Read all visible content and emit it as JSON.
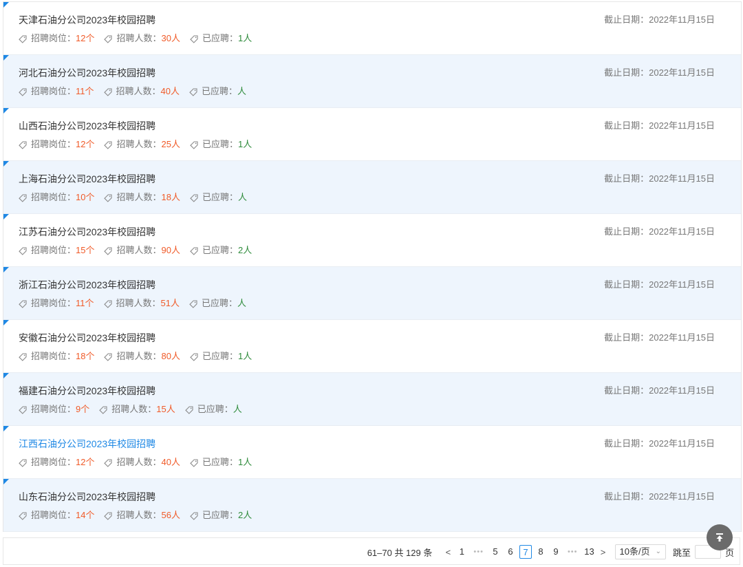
{
  "labels": {
    "positions": "招聘岗位：",
    "headcount": "招聘人数：",
    "applied": "已应聘：",
    "deadline_prefix": "截止日期："
  },
  "rows": [
    {
      "title": "天津石油分公司2023年校园招聘",
      "positions": "12个",
      "headcount": "30人",
      "applied": "1人",
      "deadline": "2022年11月15日"
    },
    {
      "title": "河北石油分公司2023年校园招聘",
      "positions": "11个",
      "headcount": "40人",
      "applied": "人",
      "deadline": "2022年11月15日"
    },
    {
      "title": "山西石油分公司2023年校园招聘",
      "positions": "12个",
      "headcount": "25人",
      "applied": "1人",
      "deadline": "2022年11月15日"
    },
    {
      "title": "上海石油分公司2023年校园招聘",
      "positions": "10个",
      "headcount": "18人",
      "applied": "人",
      "deadline": "2022年11月15日"
    },
    {
      "title": "江苏石油分公司2023年校园招聘",
      "positions": "15个",
      "headcount": "90人",
      "applied": "2人",
      "deadline": "2022年11月15日"
    },
    {
      "title": "浙江石油分公司2023年校园招聘",
      "positions": "11个",
      "headcount": "51人",
      "applied": "人",
      "deadline": "2022年11月15日"
    },
    {
      "title": "安徽石油分公司2023年校园招聘",
      "positions": "18个",
      "headcount": "80人",
      "applied": "1人",
      "deadline": "2022年11月15日"
    },
    {
      "title": "福建石油分公司2023年校园招聘",
      "positions": "9个",
      "headcount": "15人",
      "applied": "人",
      "deadline": "2022年11月15日"
    },
    {
      "title": "江西石油分公司2023年校园招聘",
      "positions": "12个",
      "headcount": "40人",
      "applied": "1人",
      "deadline": "2022年11月15日",
      "highlighted": true
    },
    {
      "title": "山东石油分公司2023年校园招聘",
      "positions": "14个",
      "headcount": "56人",
      "applied": "2人",
      "deadline": "2022年11月15日"
    }
  ],
  "pagination": {
    "total_text": "61–70 共 129 条",
    "prev": "<",
    "next": ">",
    "pages": [
      "1",
      "•••",
      "5",
      "6",
      "7",
      "8",
      "9",
      "•••",
      "13"
    ],
    "current": "7",
    "page_size": "10条/页",
    "jump_label": "跳至",
    "page_unit": "页"
  },
  "colors": {
    "accent": "#1e88e5",
    "value_orange": "#f05a28",
    "value_green": "#2e8b3b",
    "row_alt": "#eef5fd"
  },
  "icons": {
    "tag": "tag-icon",
    "back_to_top": "arrow-up-to-line-icon"
  }
}
